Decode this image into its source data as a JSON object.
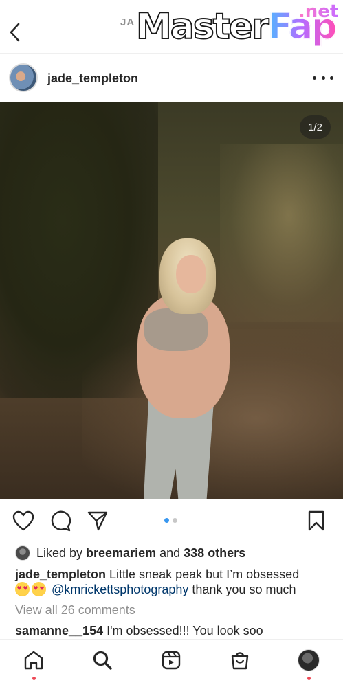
{
  "header": {
    "title": "JA",
    "watermark": {
      "brand_a": "Master",
      "brand_b": "Fap",
      "suffix": ".net"
    }
  },
  "post": {
    "username": "jade_templeton",
    "slide_counter": "1/2",
    "slide_count": 2,
    "active_slide": 1
  },
  "likes": {
    "prefix": "Liked by",
    "user": "breemariem",
    "joiner": "and",
    "others": "338 others"
  },
  "caption": {
    "username": "jade_templeton",
    "text": "Little sneak peak but I’m obsessed",
    "emojis": [
      "heart-eyes-emoji",
      "heart-eyes-emoji"
    ],
    "mention": "@kmrickettsphotography",
    "suffix": "thank you so much"
  },
  "view_comments": "View all 26 comments",
  "comment": {
    "username": "samanne__154",
    "text": "I'm obsessed!!! You look soo"
  },
  "nav": {
    "items": [
      "home-icon",
      "search-icon",
      "reels-icon",
      "shop-icon",
      "profile-avatar"
    ]
  },
  "colors": {
    "accent_blue": "#3897f0",
    "mention_blue": "#00376b",
    "notification_red": "#ed4956",
    "muted_gray": "#8e8e8e"
  }
}
